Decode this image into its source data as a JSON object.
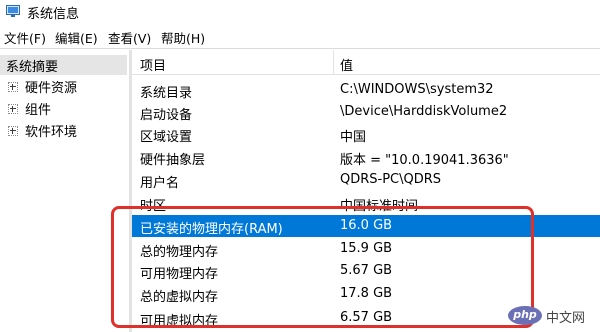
{
  "window": {
    "title": "系统信息"
  },
  "menu": [
    {
      "label": "文件(F)"
    },
    {
      "label": "编辑(E)"
    },
    {
      "label": "查看(V)"
    },
    {
      "label": "帮助(H)"
    }
  ],
  "tree": {
    "root": "系统摘要",
    "children": [
      {
        "label": "硬件资源"
      },
      {
        "label": "组件"
      },
      {
        "label": "软件环境"
      }
    ]
  },
  "table": {
    "headers": {
      "item": "项目",
      "value": "值"
    },
    "rows": [
      {
        "item": "系统目录",
        "value": "C:\\WINDOWS\\system32"
      },
      {
        "item": "启动设备",
        "value": "\\Device\\HarddiskVolume2"
      },
      {
        "item": "区域设置",
        "value": "中国"
      },
      {
        "item": "硬件抽象层",
        "value": "版本 = \"10.0.19041.3636\""
      },
      {
        "item": "用户名",
        "value": "QDRS-PC\\QDRS"
      },
      {
        "item": "时区",
        "value": "中国标准时间"
      },
      {
        "item": "已安装的物理内存(RAM)",
        "value": "16.0 GB",
        "selected": true
      },
      {
        "item": "总的物理内存",
        "value": "15.9 GB"
      },
      {
        "item": "可用物理内存",
        "value": "5.67 GB"
      },
      {
        "item": "总的虚拟内存",
        "value": "17.8 GB"
      },
      {
        "item": "可用虚拟内存",
        "value": "6.57 GB"
      }
    ]
  },
  "colors": {
    "selection": "#0078d7",
    "annotation": "#e0302b"
  },
  "watermark": {
    "logo": "php",
    "text": "中文网"
  }
}
